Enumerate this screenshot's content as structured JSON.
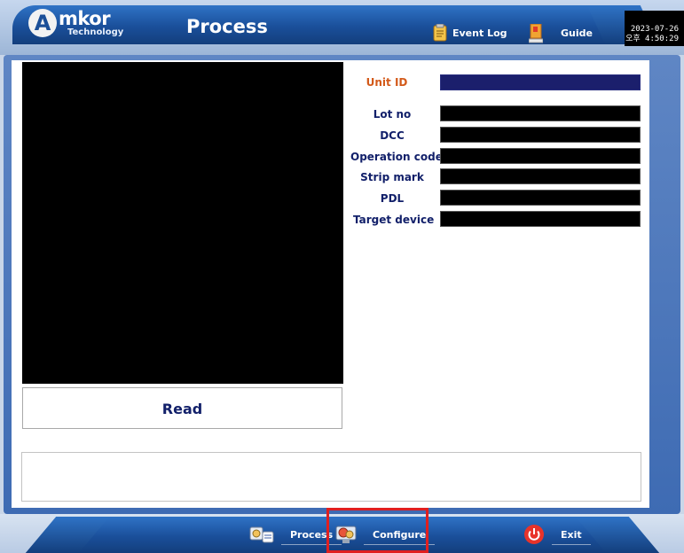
{
  "header": {
    "logo_letter": "A",
    "logo_word": "mkor",
    "logo_sub": "Technology",
    "title": "Process",
    "event_log_label": "Event Log",
    "guide_label": "Guide",
    "date": "2023-07-26",
    "time": "오후 4:50:29"
  },
  "form": {
    "unit_id_label": "Unit ID",
    "unit_id_value": "",
    "lot_no_label": "Lot no",
    "lot_no_value": "",
    "dcc_label": "DCC",
    "dcc_value": "",
    "operation_code_label": "Operation code",
    "operation_code_value": "",
    "strip_mark_label": "Strip mark",
    "strip_mark_value": "",
    "pdl_label": "PDL",
    "pdl_value": "",
    "target_device_label": "Target device",
    "target_device_value": ""
  },
  "read_button_label": "Read",
  "message_text": "",
  "footer": {
    "process_label": "Process",
    "configure_label": "Configure",
    "exit_label": "Exit"
  },
  "colors": {
    "header_blue": "#1a4f9a",
    "label_navy": "#12206a",
    "unit_id_orange": "#d35a1a",
    "highlight_red": "#e01f1f",
    "exit_red": "#e8332a"
  },
  "icons": [
    "event-log-icon",
    "guide-icon",
    "process-icon",
    "configure-icon",
    "power-icon"
  ]
}
